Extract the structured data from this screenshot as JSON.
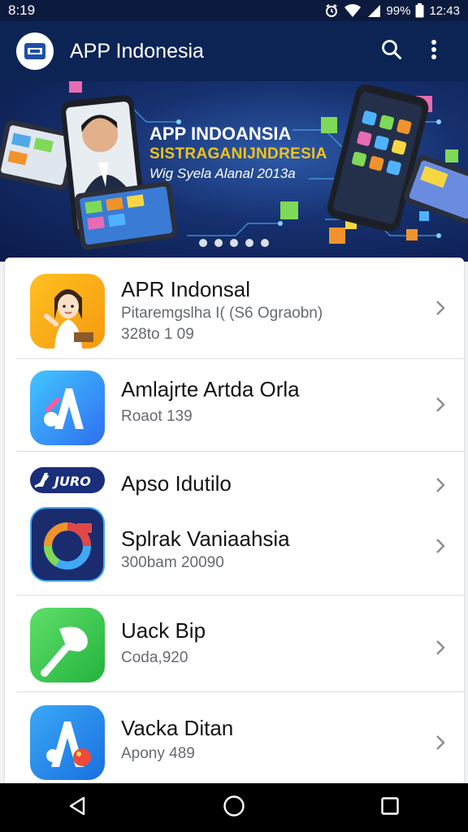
{
  "status_bar": {
    "time": "8:19",
    "battery": "99%",
    "clock": "12:43"
  },
  "app_bar": {
    "title": "APP Indonesia",
    "actions": [
      "search-icon",
      "more-vert-icon"
    ]
  },
  "banner": {
    "title": "APP INDOANSIA",
    "subtitle": "SISTRAGANIJNDRESIA",
    "caption": "Wig Syela Alanal 2013a",
    "dots": 5,
    "accent_color": "#f1c21a"
  },
  "apps": [
    {
      "title": "APR Indonsal",
      "subtitle": "Pitaremgslha I( (S6 Ograobn)",
      "meta": "328to 1 09",
      "icon": "cartoon-girl-app-icon"
    },
    {
      "title": "Amlajrte Artda Orla",
      "subtitle": "Roaot 139",
      "icon": "letter-a-app-icon"
    },
    {
      "title": "Apso Idutilo",
      "icon": "juro-logo-icon"
    },
    {
      "title": "Splrak Vaniaahsia",
      "subtitle": "300bam 20090",
      "icon": "colorful-ring-app-icon"
    },
    {
      "title": "Uack Bip",
      "subtitle": "Coda,920",
      "icon": "green-leaf-app-icon"
    },
    {
      "title": "Vacka Ditan",
      "subtitle": "Apony 489",
      "icon": "blue-a-app-icon"
    }
  ],
  "nav": [
    "back-icon",
    "home-icon",
    "recents-icon"
  ]
}
